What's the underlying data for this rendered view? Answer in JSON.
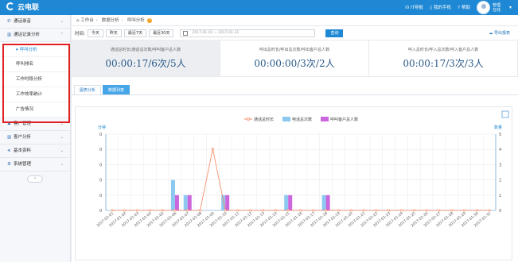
{
  "app": {
    "title": "云电联"
  },
  "topbar": {
    "items": [
      "IT导航",
      "我的手机",
      "帮助"
    ],
    "user_line1": "管理",
    "user_line2": "在线"
  },
  "sidebar": {
    "items": [
      {
        "label": "通话录音",
        "icon": "phone-icon"
      },
      {
        "label": "通话记录分析",
        "icon": "bar-chart-icon",
        "expanded": true
      },
      {
        "label": "客户管理",
        "icon": "group-icon"
      },
      {
        "label": "客户分析",
        "icon": "bar-chart-icon"
      },
      {
        "label": "基本资料",
        "icon": "share-icon"
      },
      {
        "label": "系统管理",
        "icon": "gears-icon"
      }
    ],
    "subitems": [
      "呼叫分析",
      "呼叫排名",
      "工作时段分析",
      "工作效率统计",
      "广告情况"
    ],
    "collapse_label": "«"
  },
  "breadcrumb": {
    "home": "工作台",
    "level2": "数据分析",
    "level3": "呼叫分析"
  },
  "filter": {
    "label": "时间:",
    "buttons": [
      "今天",
      "昨天",
      "最近7天",
      "最近30天"
    ],
    "date_range": "2017-01-01 ~ 2017-01-31",
    "query": "查询",
    "export": "导出报表"
  },
  "stats": [
    {
      "label": "通话总时长/通话总次数/呼叫客户总人数",
      "value": "00:00:17/6次/5人"
    },
    {
      "label": "呼出总时长/呼出总次数/呼出客户总人数",
      "value": "00:00:00/3次/2人"
    },
    {
      "label": "呼入总时长/呼入总次数/呼入客户总人数",
      "value": "00:00:17/3次/3人"
    }
  ],
  "tabs": [
    "图表分析",
    "数据列表"
  ],
  "chart_data": {
    "type": "bar",
    "legend": [
      "通话总时长",
      "电话总次数",
      "呼叫客户总人数"
    ],
    "legend_placement": "top-center",
    "left_axis_label": "分钟",
    "right_axis_label": "数量",
    "left_ticks": [
      "0",
      "0",
      "0",
      "0",
      "0",
      "0"
    ],
    "right_ticks": [
      "0",
      "1",
      "2",
      "3",
      "4",
      "5"
    ],
    "ylim_right": [
      0,
      5
    ],
    "categories": [
      "2017-01-01",
      "2017-01-02",
      "2017-01-03",
      "2017-01-04",
      "2017-01-05",
      "2017-01-06",
      "2017-01-07",
      "2017-01-08",
      "2017-01-09",
      "2017-01-10",
      "2017-01-11",
      "2017-01-12",
      "2017-01-13",
      "2017-01-14",
      "2017-01-15",
      "2017-01-16",
      "2017-01-17",
      "2017-01-18",
      "2017-01-19",
      "2017-01-20",
      "2017-01-21",
      "2017-01-22",
      "2017-01-23",
      "2017-01-24",
      "2017-01-25",
      "2017-01-26",
      "2017-01-27",
      "2017-01-28",
      "2017-01-29",
      "2017-01-30",
      "2017-01-31"
    ],
    "series": [
      {
        "name": "通话总时长",
        "kind": "line",
        "color": "#f5845a",
        "values": [
          0,
          0,
          0,
          0,
          0,
          0,
          0,
          0,
          0.283,
          0,
          0,
          0,
          0,
          0,
          0,
          0,
          0,
          0,
          0,
          0,
          0,
          0,
          0,
          0,
          0,
          0,
          0,
          0,
          0,
          0,
          0
        ]
      },
      {
        "name": "电话总次数",
        "kind": "bar",
        "color": "#8cc8f0",
        "values": [
          0,
          0,
          0,
          0,
          0,
          2,
          1,
          0,
          0,
          1,
          0,
          0,
          0,
          0,
          1,
          0,
          0,
          1,
          0,
          0,
          0,
          0,
          0,
          0,
          0,
          0,
          0,
          0,
          0,
          0,
          0
        ]
      },
      {
        "name": "呼叫客户总人数",
        "kind": "bar",
        "color": "#cc66dd",
        "values": [
          0,
          0,
          0,
          0,
          0,
          1,
          1,
          0,
          0,
          1,
          0,
          0,
          0,
          0,
          1,
          0,
          0,
          1,
          0,
          0,
          0,
          0,
          0,
          0,
          0,
          0,
          0,
          0,
          0,
          0,
          0
        ]
      }
    ]
  }
}
